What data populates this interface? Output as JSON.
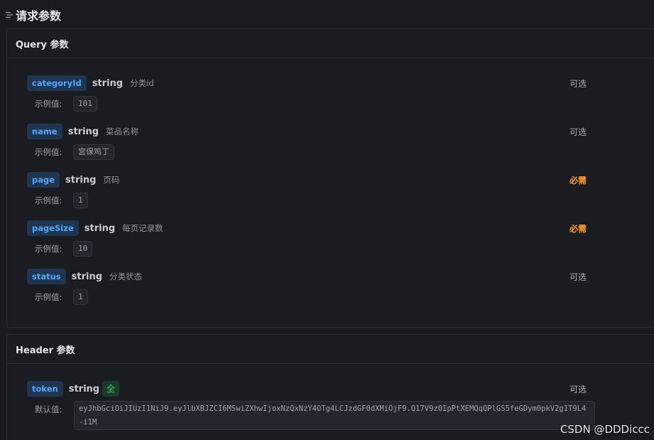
{
  "section": {
    "title": "请求参数",
    "icon": "list-icon"
  },
  "query": {
    "title": "Query 参数",
    "params": [
      {
        "name": "categoryId",
        "type": "string",
        "desc": "分类id",
        "requirement": "可选",
        "required": false,
        "example_label": "示例值:",
        "example": "101"
      },
      {
        "name": "name",
        "type": "string",
        "desc": "菜品名称",
        "requirement": "可选",
        "required": false,
        "example_label": "示例值:",
        "example": "宫保鸡丁"
      },
      {
        "name": "page",
        "type": "string",
        "desc": "页码",
        "requirement": "必需",
        "required": true,
        "example_label": "示例值:",
        "example": "1"
      },
      {
        "name": "pageSize",
        "type": "string",
        "desc": "每页记录数",
        "requirement": "必需",
        "required": true,
        "example_label": "示例值:",
        "example": "10"
      },
      {
        "name": "status",
        "type": "string",
        "desc": "分类状态",
        "requirement": "可选",
        "required": false,
        "example_label": "示例值:",
        "example": "1"
      }
    ]
  },
  "header": {
    "title": "Header 参数",
    "params": [
      {
        "name": "token",
        "type": "string",
        "badge": "全",
        "requirement": "可选",
        "default_label": "默认值:",
        "default": "eyJhbGciOiJIUzI1NiJ9.eyJlbXBJZCI6MSwiZXhwIjoxNzQxNzY4OTg4LCJzdGF0dXMiOjF9.Q17V9z0IpPtXEMQqQPlGS5feGDym0pkV2g1T9L4-i1M"
      }
    ]
  },
  "watermark": "CSDN @DDDiccc",
  "colors": {
    "accent": "#56a8ff",
    "required": "#ff9a2e",
    "badge": "#3ecb72",
    "background": "#1a1b20"
  }
}
